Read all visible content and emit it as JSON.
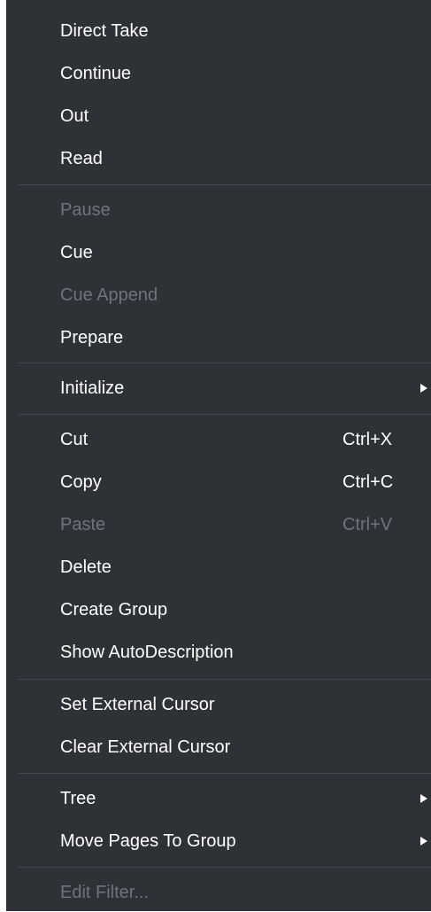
{
  "menu": {
    "items": [
      {
        "label": "Direct Take",
        "enabled": true
      },
      {
        "label": "Continue",
        "enabled": true
      },
      {
        "label": "Out",
        "enabled": true
      },
      {
        "label": "Read",
        "enabled": true
      },
      {
        "label": "Pause",
        "enabled": false
      },
      {
        "label": "Cue",
        "enabled": true
      },
      {
        "label": "Cue Append",
        "enabled": false
      },
      {
        "label": "Prepare",
        "enabled": true
      },
      {
        "label": "Initialize",
        "enabled": true,
        "submenu": true
      },
      {
        "label": "Cut",
        "shortcut": "Ctrl+X",
        "enabled": true
      },
      {
        "label": "Copy",
        "shortcut": "Ctrl+C",
        "enabled": true
      },
      {
        "label": "Paste",
        "shortcut": "Ctrl+V",
        "enabled": false
      },
      {
        "label": "Delete",
        "enabled": true
      },
      {
        "label": "Create Group",
        "enabled": true
      },
      {
        "label": "Show AutoDescription",
        "enabled": true
      },
      {
        "label": "Set External Cursor",
        "enabled": true
      },
      {
        "label": "Clear External Cursor",
        "enabled": true
      },
      {
        "label": "Tree",
        "enabled": true,
        "submenu": true
      },
      {
        "label": "Move Pages To Group",
        "enabled": true,
        "submenu": true
      },
      {
        "label": "Edit Filter...",
        "enabled": false
      }
    ]
  },
  "colors": {
    "background": "#2e3136",
    "text": "#ffffff",
    "disabled_text": "#70747a",
    "separator": "#44484e"
  }
}
